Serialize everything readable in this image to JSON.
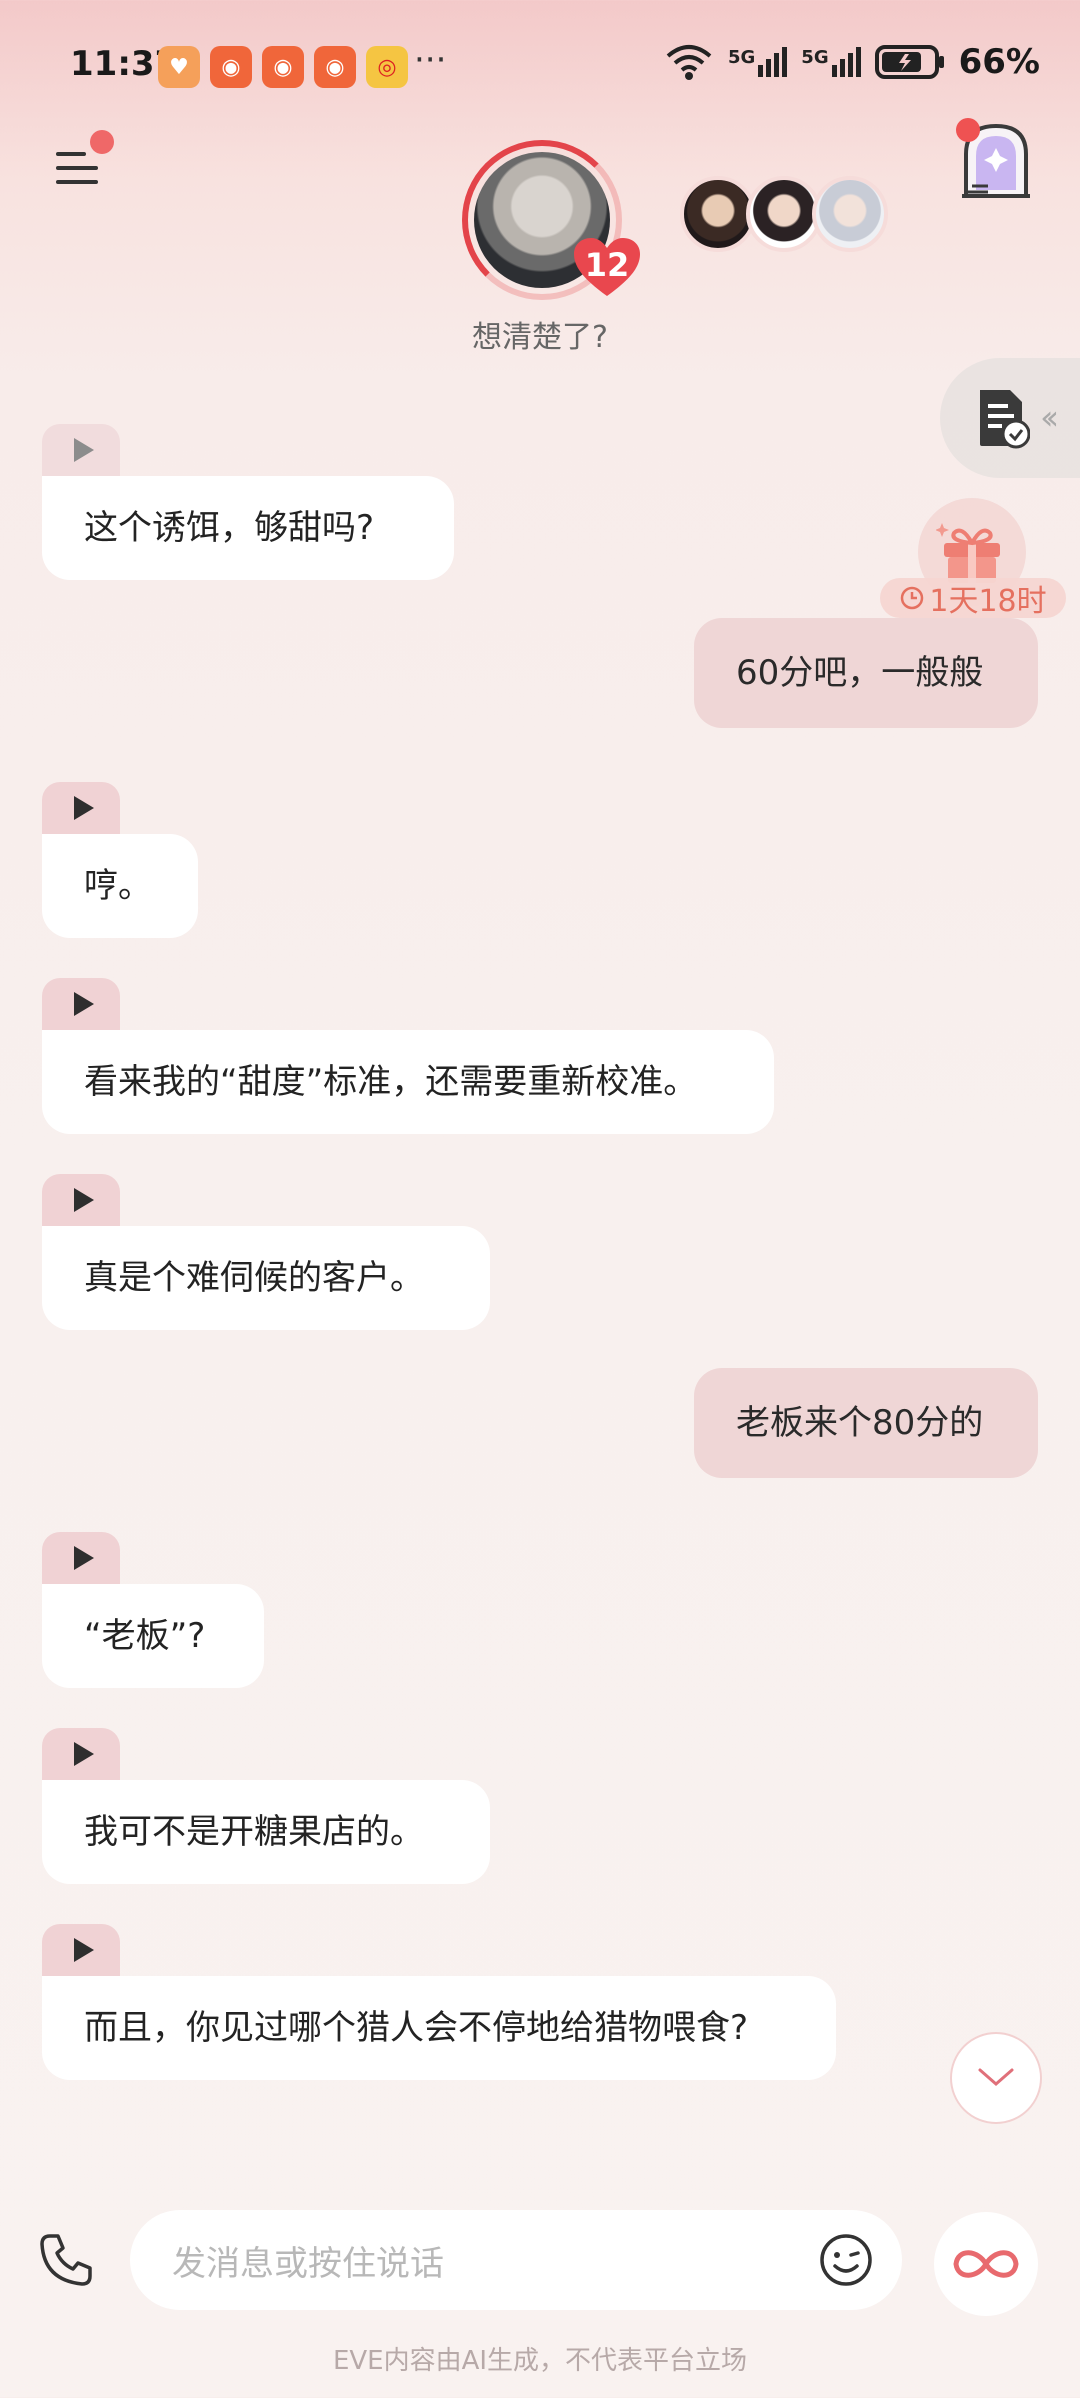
{
  "status_bar": {
    "time": "11:37",
    "network_1": "5G",
    "network_2": "5G",
    "battery": "66%",
    "more": "···",
    "app_icons": [
      "heart-app-icon",
      "kuaishou-icon",
      "kuaishou-icon",
      "kuaishou-icon",
      "weibo-icon"
    ]
  },
  "header": {
    "affection_count": "12",
    "mood": "想清楚了?"
  },
  "gift": {
    "timer": "1天18时"
  },
  "messages": [
    {
      "role": "ai",
      "text": "这个诱饵，够甜吗?"
    },
    {
      "role": "me",
      "text": "60分吧，一般般"
    },
    {
      "role": "ai",
      "text": "哼。"
    },
    {
      "role": "ai",
      "text": "看来我的“甜度”标准，还需要重新校准。"
    },
    {
      "role": "ai",
      "text": "真是个难伺候的客户。"
    },
    {
      "role": "me",
      "text": "老板来个80分的"
    },
    {
      "role": "ai",
      "text": "“老板”?"
    },
    {
      "role": "ai",
      "text": "我可不是开糖果店的。"
    },
    {
      "role": "ai",
      "text": "而且，你见过哪个猎人会不停地给猎物喂食?"
    }
  ],
  "input": {
    "placeholder": "发消息或按住说话"
  },
  "footer": {
    "disclaimer": "EVE内容由AI生成，不代表平台立场"
  },
  "colors": {
    "accent": "#e3444a",
    "my_bubble": "#efd6d6",
    "ai_bubble": "#ffffff"
  }
}
